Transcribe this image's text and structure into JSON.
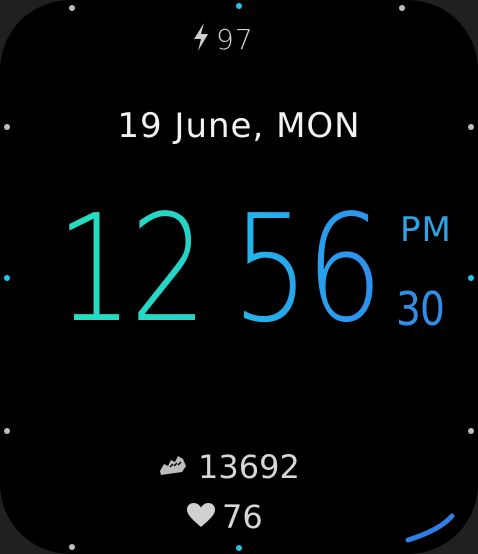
{
  "battery": {
    "icon": "lightning-bolt-icon",
    "value": "97"
  },
  "date": {
    "text": "19 June, MON"
  },
  "time": {
    "hour": "12",
    "minute": "56",
    "ampm": "PM",
    "seconds": "30"
  },
  "steps": {
    "icon": "shoe-icon",
    "value": "13692"
  },
  "heart_rate": {
    "icon": "heart-icon",
    "value": "76"
  },
  "colors": {
    "hour": "#25e0c0",
    "minute": "#23b8e8",
    "ampm": "#2fa3e6",
    "seconds": "#2f8fe8",
    "accent_tick": "#22c5ee",
    "text": "#e8e8e8"
  }
}
